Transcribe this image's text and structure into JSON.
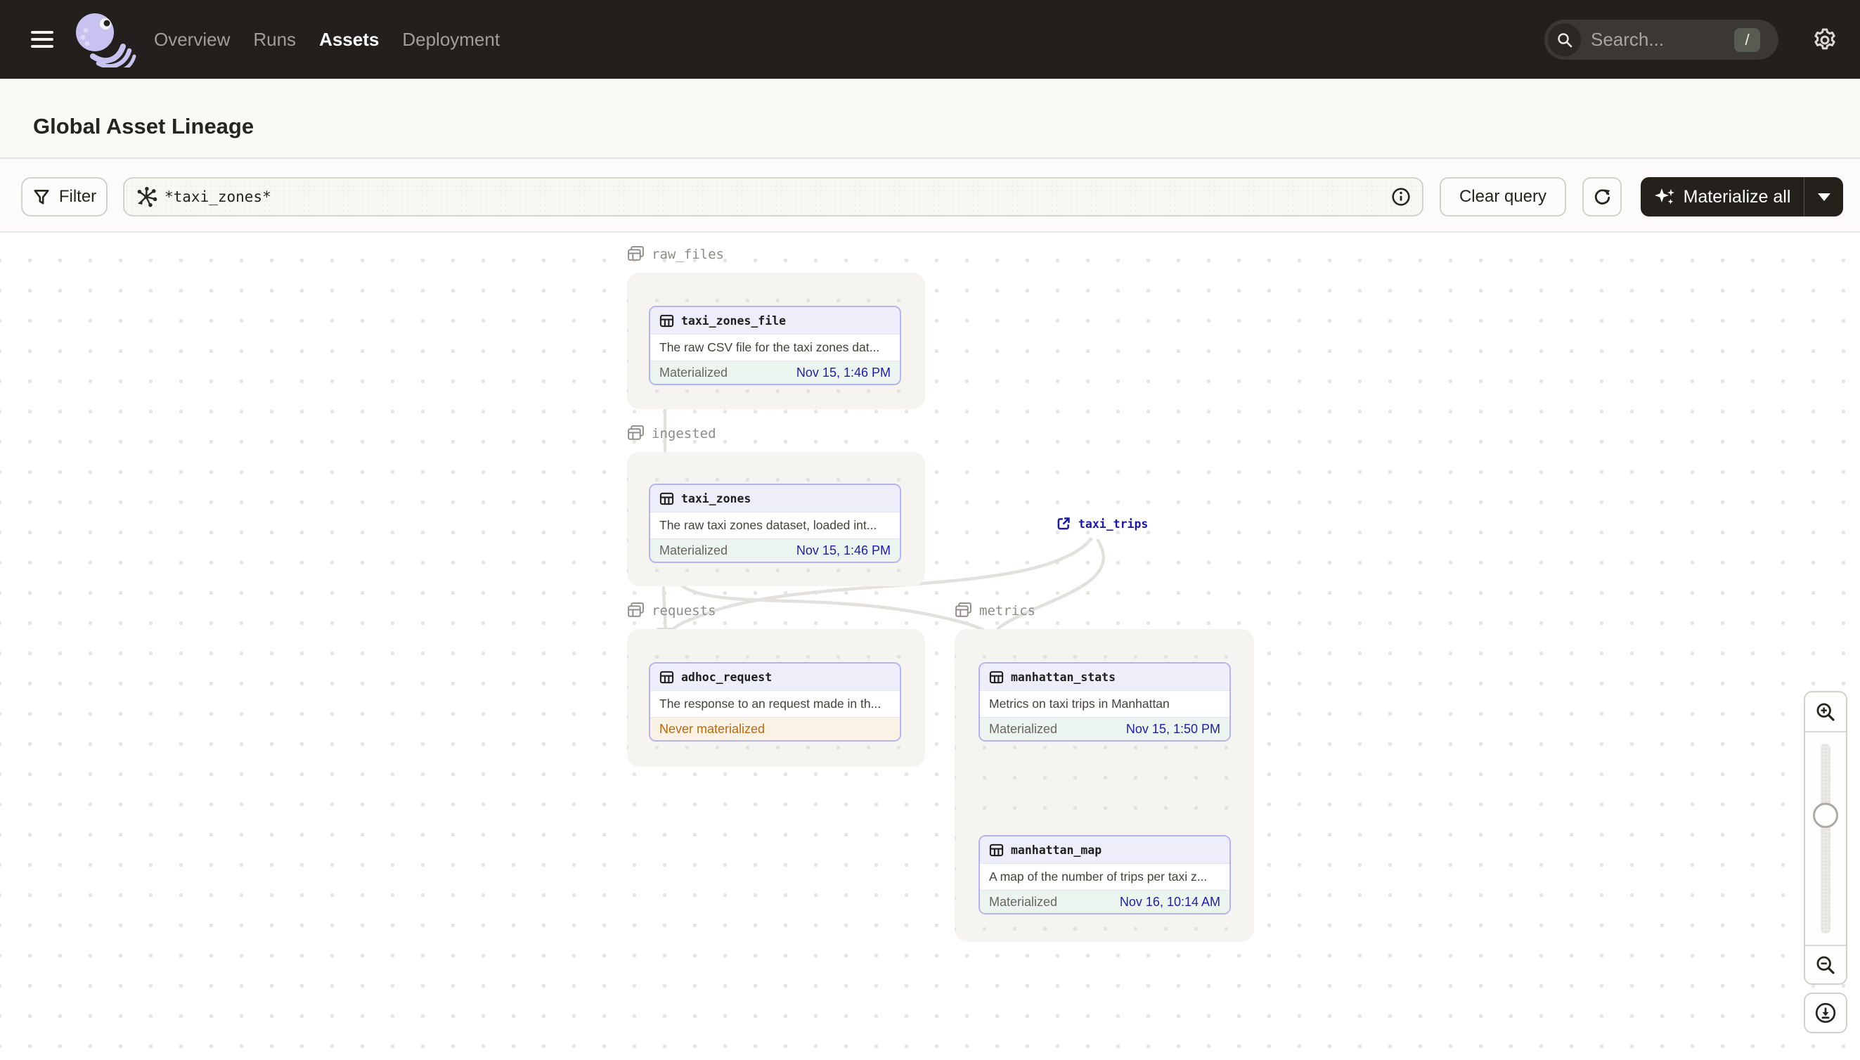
{
  "header": {
    "nav": [
      {
        "label": "Overview",
        "active": false
      },
      {
        "label": "Runs",
        "active": false
      },
      {
        "label": "Assets",
        "active": true
      },
      {
        "label": "Deployment",
        "active": false
      }
    ],
    "search_placeholder": "Search...",
    "search_shortcut": "/"
  },
  "titlebar": {
    "title": "Global Asset Lineage",
    "reload_label": "Reload definitions"
  },
  "toolbar": {
    "filter_label": "Filter",
    "query_value": "*taxi_zones*",
    "clear_label": "Clear query",
    "materialize_label": "Materialize all"
  },
  "graph": {
    "groups": [
      {
        "label": "raw_files"
      },
      {
        "label": "ingested"
      },
      {
        "label": "requests"
      },
      {
        "label": "metrics"
      }
    ],
    "nodes": [
      {
        "title": "taxi_zones_file",
        "description": "The raw CSV file for the taxi zones dat...",
        "status": "Materialized",
        "timestamp": "Nov 15, 1:46 PM",
        "status_kind": "materialized",
        "group": "raw_files"
      },
      {
        "title": "taxi_zones",
        "description": "The raw taxi zones dataset, loaded int...",
        "status": "Materialized",
        "timestamp": "Nov 15, 1:46 PM",
        "status_kind": "materialized",
        "group": "ingested"
      },
      {
        "title": "adhoc_request",
        "description": "The response to an request made in th...",
        "status": "Never materialized",
        "status_kind": "never_materialized",
        "group": "requests"
      },
      {
        "title": "manhattan_stats",
        "description": "Metrics on taxi trips in Manhattan",
        "status": "Materialized",
        "timestamp": "Nov 15, 1:50 PM",
        "status_kind": "materialized",
        "group": "metrics"
      },
      {
        "title": "manhattan_map",
        "description": "A map of the number of trips per taxi z...",
        "status": "Materialized",
        "timestamp": "Nov 16, 10:14 AM",
        "status_kind": "materialized",
        "group": "metrics"
      }
    ],
    "external_assets": [
      {
        "label": "taxi_trips"
      }
    ],
    "edges": [
      {
        "from": "taxi_zones_file",
        "to": "taxi_zones"
      },
      {
        "from": "taxi_zones",
        "to": "adhoc_request"
      },
      {
        "from": "taxi_zones",
        "to": "manhattan_stats"
      },
      {
        "from": "taxi_trips",
        "to": "adhoc_request"
      },
      {
        "from": "taxi_trips",
        "to": "manhattan_stats"
      },
      {
        "from": "manhattan_stats",
        "to": "manhattan_map"
      }
    ]
  },
  "icons": {
    "hamburger": "menu",
    "dagster-logo": "octopus",
    "search": "magnifier",
    "settings": "gear",
    "reload": "circular-arrow",
    "filter": "funnel",
    "query": "op-selector-graph",
    "info": "circled-i",
    "materialize": "sparkles",
    "asset": "table-grid",
    "asset-group": "layered-tables",
    "external-asset": "external-link",
    "zoom-in": "magnifier-plus",
    "zoom-out": "magnifier-minus",
    "download": "circled-down-arrow"
  },
  "colors": {
    "header_bg": "#221F1C",
    "accent_lavender": "#B7B5E7",
    "node_header": "#EEEDFA",
    "materialized_bg": "#EBF4EF",
    "never_materialized_bg": "#FAF3E5",
    "never_materialized_text": "#B66A10",
    "timestamp_text": "#201FA0",
    "edge": "#E3E1DD"
  }
}
